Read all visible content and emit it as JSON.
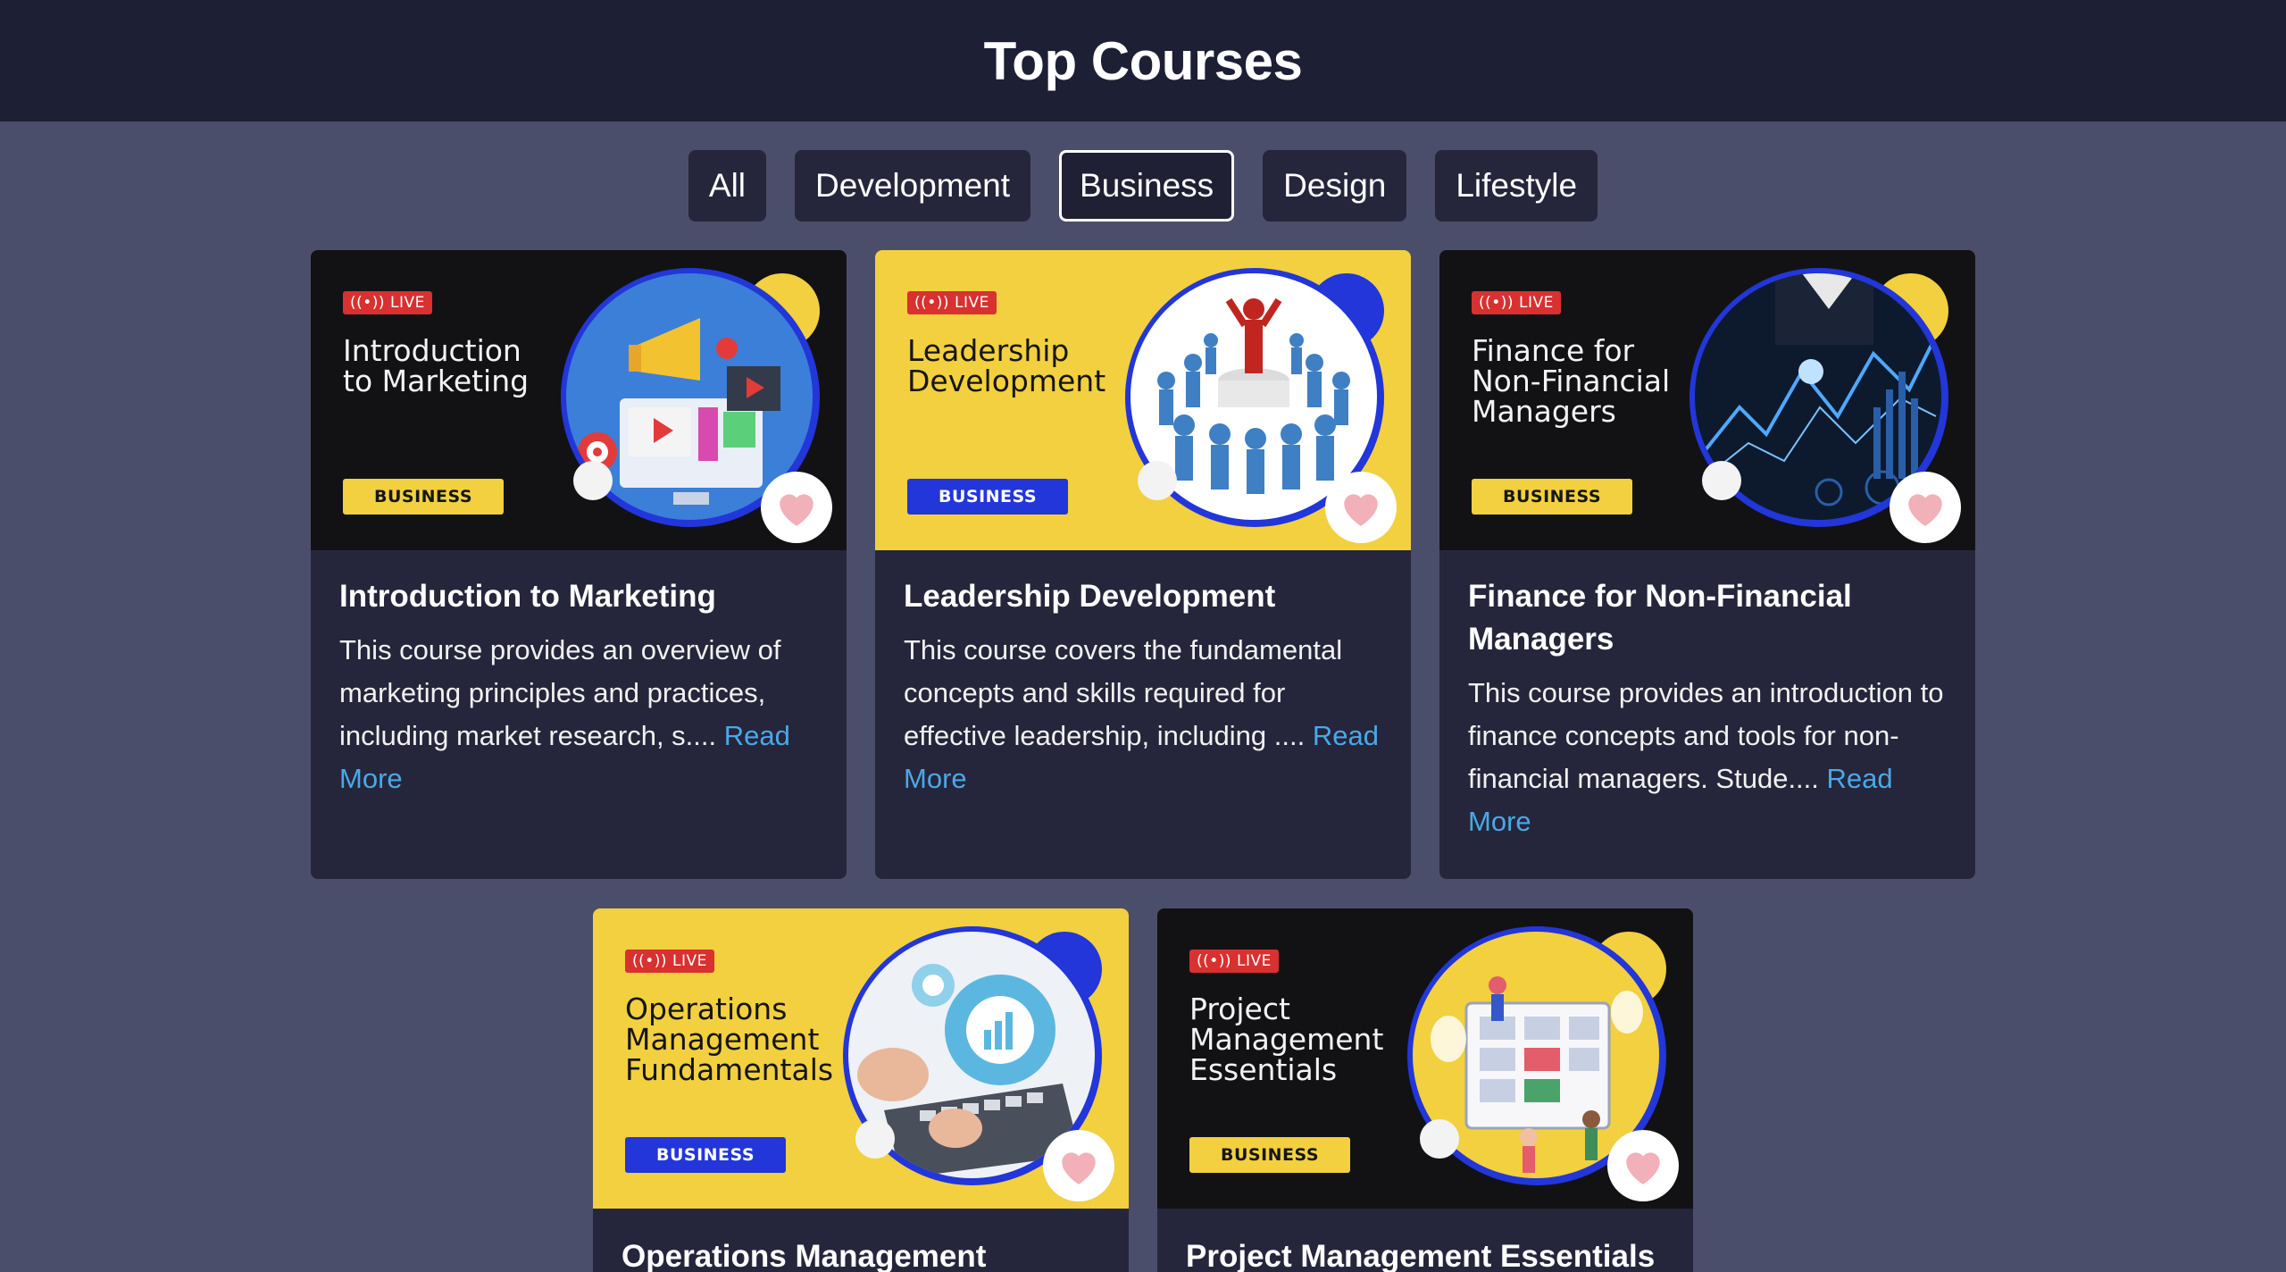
{
  "header": {
    "title": "Top Courses"
  },
  "filters": [
    {
      "label": "All",
      "active": false
    },
    {
      "label": "Development",
      "active": false
    },
    {
      "label": "Business",
      "active": true
    },
    {
      "label": "Design",
      "active": false
    },
    {
      "label": "Lifestyle",
      "active": false
    }
  ],
  "live_label": "LIVE",
  "read_more_label": "Read More",
  "courses": [
    {
      "thumb_title": "Introduction to Marketing",
      "tag": "BUSINESS",
      "title": "Introduction to Marketing",
      "description": "This course provides an overview of marketing principles and practices, including market research, s....",
      "theme": "dark"
    },
    {
      "thumb_title": "Leadership Development",
      "tag": "BUSINESS",
      "title": "Leadership Development",
      "description": "This course covers the fundamental concepts and skills required for effective leadership, including ....",
      "theme": "yellow"
    },
    {
      "thumb_title": "Finance for Non-Financial Managers",
      "tag": "BUSINESS",
      "title": "Finance for Non-Financial Managers",
      "description": "This course provides an introduction to finance concepts and tools for non-financial managers. Stude....",
      "theme": "dark"
    },
    {
      "thumb_title": "Operations Management Fundamentals",
      "tag": "BUSINESS",
      "title": "Operations Management",
      "description": "",
      "theme": "yellow"
    },
    {
      "thumb_title": "Project Management Essentials",
      "tag": "BUSINESS",
      "title": "Project Management Essentials",
      "description": "",
      "theme": "dark"
    }
  ],
  "colors": {
    "header_bg": "#1d1f35",
    "page_bg": "#4b4e6b",
    "card_bg": "#25263b",
    "link": "#4aa8e8",
    "accent_yellow": "#f2d03f",
    "accent_blue": "#2236d9",
    "live_red": "#d93030"
  }
}
